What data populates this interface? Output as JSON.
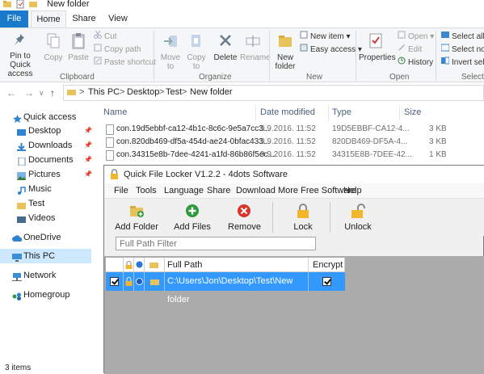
{
  "window": {
    "title": "New folder"
  },
  "ribbon_tabs": {
    "file": "File",
    "home": "Home",
    "share": "Share",
    "view": "View"
  },
  "ribbon": {
    "pin_label": "Pin to Quick access",
    "copy_label": "Copy",
    "paste_label": "Paste",
    "cut_label": "Cut",
    "copy_path_label": "Copy path",
    "paste_shortcut_label": "Paste shortcut",
    "clipboard_group": "Clipboard",
    "move_to_label": "Move to",
    "copy_to_label": "Copy to",
    "delete_label": "Delete",
    "rename_label": "Rename",
    "organize_group": "Organize",
    "new_folder_label": "New folder",
    "new_item_label": "New item",
    "easy_access_label": "Easy access",
    "new_group": "New",
    "properties_label": "Properties",
    "open_label": "Open",
    "edit_label": "Edit",
    "history_label": "History",
    "open_group": "Open",
    "select_all_label": "Select all",
    "select_none_label": "Select non",
    "invert_selection_label": "Invert sele",
    "select_group": "Select"
  },
  "address": {
    "crumbs": [
      "This PC",
      "Desktop",
      "Test",
      "New folder"
    ],
    "separator": ">"
  },
  "nav": {
    "quick_access": "Quick access",
    "items": [
      "Desktop",
      "Downloads",
      "Documents",
      "Pictures",
      "Music",
      "Test",
      "Videos"
    ],
    "onedrive": "OneDrive",
    "this_pc": "This PC",
    "network": "Network",
    "homegroup": "Homegroup"
  },
  "columns": {
    "name": "Name",
    "date": "Date modified",
    "type": "Type",
    "size": "Size"
  },
  "files": [
    {
      "name": "con.19d5ebbf-ca12-4b1c-8c6c-9e5a7cc3...",
      "date": "9.9.2016. 11:52",
      "type": "19D5EBBF-CA12-4...",
      "size": "3 KB"
    },
    {
      "name": "con.820db469-df5a-454d-ae24-0bfac433...",
      "date": "9.9.2016. 11:52",
      "type": "820DB469-DF5A-4...",
      "size": "3 KB"
    },
    {
      "name": "con.34315e8b-7dee-4241-a1fd-86b86f5ec...",
      "date": "9.9.2016. 11:52",
      "type": "34315E8B-7DEE-42...",
      "size": "1 KB"
    }
  ],
  "status": {
    "items": "3 items"
  },
  "qfl": {
    "title": "Quick File Locker V1.2.2 - 4dots Software",
    "menu": [
      "File",
      "Tools",
      "Language",
      "Share",
      "Download More Free Software",
      "Help"
    ],
    "toolbar": {
      "add_folder": "Add Folder",
      "add_files": "Add Files",
      "remove": "Remove",
      "lock": "Lock",
      "unlock": "Unlock"
    },
    "filter_placeholder": "Full Path Filter",
    "grid": {
      "col_full_path": "Full Path",
      "col_encrypt": "Encrypt",
      "rows": [
        {
          "path": "C:\\Users\\Jon\\Desktop\\Test\\New folder",
          "checked": true,
          "encrypt": true
        }
      ]
    }
  },
  "colors": {
    "accent": "#1979ca",
    "selection": "#3399ff",
    "nav_selected": "#cde8ff"
  }
}
